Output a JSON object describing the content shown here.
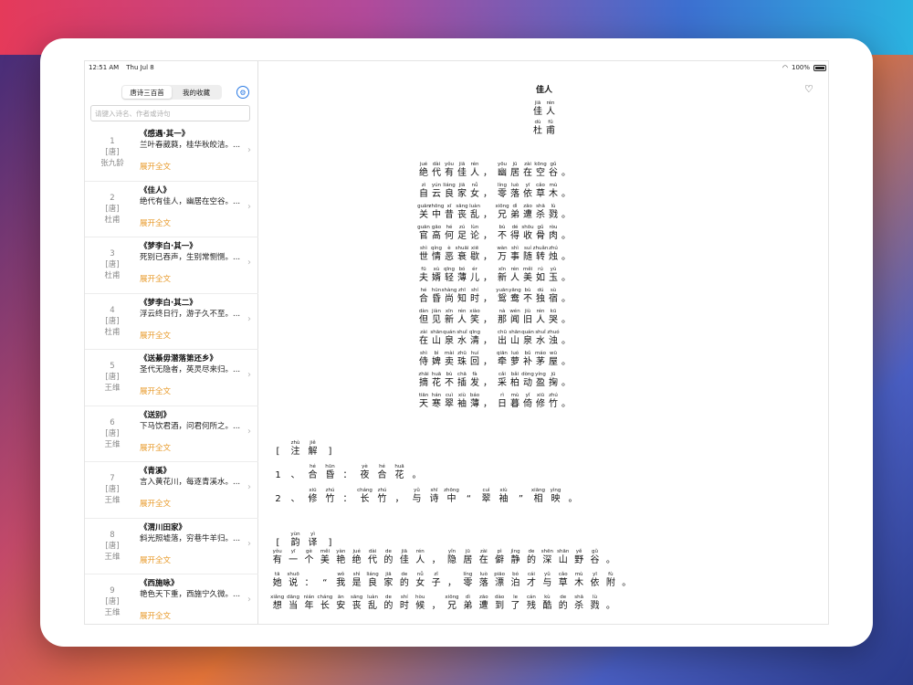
{
  "status": {
    "time": "12:51 AM",
    "date": "Thu Jul 8",
    "battery": "100%"
  },
  "sidebar": {
    "tabs": [
      {
        "label": "唐诗三百首"
      },
      {
        "label": "我的收藏"
      }
    ],
    "search_placeholder": "请键入诗名、作者或诗句",
    "items": [
      {
        "index": "1",
        "dynasty": "[唐]",
        "author": "张九龄",
        "title": "《感遇·其一》",
        "excerpt": "兰叶春葳蕤，桂华秋皎洁。...",
        "expand": "展开全文"
      },
      {
        "index": "2",
        "dynasty": "[唐]",
        "author": "杜甫",
        "title": "《佳人》",
        "excerpt": "绝代有佳人，幽居在空谷。...",
        "expand": "展开全文"
      },
      {
        "index": "3",
        "dynasty": "[唐]",
        "author": "杜甫",
        "title": "《梦李白·其一》",
        "excerpt": "死别已吞声，生别常恻恻。...",
        "expand": "展开全文"
      },
      {
        "index": "4",
        "dynasty": "[唐]",
        "author": "杜甫",
        "title": "《梦李白·其二》",
        "excerpt": "浮云终日行，游子久不至。...",
        "expand": "展开全文"
      },
      {
        "index": "5",
        "dynasty": "[唐]",
        "author": "王维",
        "title": "《送綦毋潜落第还乡》",
        "excerpt": "圣代无隐者，英灵尽来归。...",
        "expand": "展开全文"
      },
      {
        "index": "6",
        "dynasty": "[唐]",
        "author": "王维",
        "title": "《送别》",
        "excerpt": "下马饮君酒，问君何所之。...",
        "expand": "展开全文"
      },
      {
        "index": "7",
        "dynasty": "[唐]",
        "author": "王维",
        "title": "《青溪》",
        "excerpt": "言入黄花川，每逐青溪水。...",
        "expand": "展开全文"
      },
      {
        "index": "8",
        "dynasty": "[唐]",
        "author": "王维",
        "title": "《渭川田家》",
        "excerpt": "斜光照墟落，穷巷牛羊归。...",
        "expand": "展开全文"
      },
      {
        "index": "9",
        "dynasty": "[唐]",
        "author": "王维",
        "title": "《西施咏》",
        "excerpt": "艳色天下重，西施宁久微。...",
        "expand": "展开全文"
      }
    ]
  },
  "main": {
    "title": "佳人",
    "head_title": [
      [
        "jiā",
        "佳"
      ],
      [
        "rén",
        "人"
      ]
    ],
    "head_author": [
      [
        "dù",
        "杜"
      ],
      [
        "fǔ",
        "甫"
      ]
    ],
    "poem_lines": [
      [
        [
          "jué",
          "绝"
        ],
        [
          "dài",
          "代"
        ],
        [
          "yǒu",
          "有"
        ],
        [
          "jiā",
          "佳"
        ],
        [
          "rén",
          "人"
        ],
        [
          "",
          "，"
        ],
        [
          "yōu",
          "幽"
        ],
        [
          "jū",
          "居"
        ],
        [
          "zài",
          "在"
        ],
        [
          "kōng",
          "空"
        ],
        [
          "gǔ",
          "谷"
        ],
        [
          "",
          "。"
        ]
      ],
      [
        [
          "zì",
          "自"
        ],
        [
          "yún",
          "云"
        ],
        [
          "liáng",
          "良"
        ],
        [
          "jiā",
          "家"
        ],
        [
          "nǚ",
          "女"
        ],
        [
          "",
          "，"
        ],
        [
          "líng",
          "零"
        ],
        [
          "luò",
          "落"
        ],
        [
          "yī",
          "依"
        ],
        [
          "cǎo",
          "草"
        ],
        [
          "mù",
          "木"
        ],
        [
          "",
          "。"
        ]
      ],
      [
        [
          "guān",
          "关"
        ],
        [
          "zhōng",
          "中"
        ],
        [
          "xī",
          "昔"
        ],
        [
          "sāng",
          "丧"
        ],
        [
          "luàn",
          "乱"
        ],
        [
          "",
          "，"
        ],
        [
          "xiōng",
          "兄"
        ],
        [
          "dì",
          "弟"
        ],
        [
          "zāo",
          "遭"
        ],
        [
          "shā",
          "杀"
        ],
        [
          "lù",
          "戮"
        ],
        [
          "",
          "。"
        ]
      ],
      [
        [
          "guān",
          "官"
        ],
        [
          "gāo",
          "高"
        ],
        [
          "hé",
          "何"
        ],
        [
          "zú",
          "足"
        ],
        [
          "lùn",
          "论"
        ],
        [
          "",
          "，"
        ],
        [
          "bù",
          "不"
        ],
        [
          "dé",
          "得"
        ],
        [
          "shōu",
          "收"
        ],
        [
          "gǔ",
          "骨"
        ],
        [
          "ròu",
          "肉"
        ],
        [
          "",
          "。"
        ]
      ],
      [
        [
          "shì",
          "世"
        ],
        [
          "qíng",
          "情"
        ],
        [
          "è",
          "恶"
        ],
        [
          "shuāi",
          "衰"
        ],
        [
          "xiē",
          "歇"
        ],
        [
          "",
          "，"
        ],
        [
          "wàn",
          "万"
        ],
        [
          "shì",
          "事"
        ],
        [
          "suí",
          "随"
        ],
        [
          "zhuǎn",
          "转"
        ],
        [
          "zhú",
          "烛"
        ],
        [
          "",
          "。"
        ]
      ],
      [
        [
          "fū",
          "夫"
        ],
        [
          "xù",
          "婿"
        ],
        [
          "qīng",
          "轻"
        ],
        [
          "bó",
          "薄"
        ],
        [
          "ér",
          "儿"
        ],
        [
          "",
          "，"
        ],
        [
          "xīn",
          "新"
        ],
        [
          "rén",
          "人"
        ],
        [
          "měi",
          "美"
        ],
        [
          "rú",
          "如"
        ],
        [
          "yù",
          "玉"
        ],
        [
          "",
          "。"
        ]
      ],
      [
        [
          "hé",
          "合"
        ],
        [
          "hūn",
          "昏"
        ],
        [
          "shàng",
          "尚"
        ],
        [
          "zhī",
          "知"
        ],
        [
          "shí",
          "时"
        ],
        [
          "",
          "，"
        ],
        [
          "yuān",
          "鸳"
        ],
        [
          "yāng",
          "鸯"
        ],
        [
          "bù",
          "不"
        ],
        [
          "dú",
          "独"
        ],
        [
          "sù",
          "宿"
        ],
        [
          "",
          "。"
        ]
      ],
      [
        [
          "dàn",
          "但"
        ],
        [
          "jiàn",
          "见"
        ],
        [
          "xīn",
          "新"
        ],
        [
          "rén",
          "人"
        ],
        [
          "xiào",
          "笑"
        ],
        [
          "",
          "，"
        ],
        [
          "nà",
          "那"
        ],
        [
          "wén",
          "闻"
        ],
        [
          "jiù",
          "旧"
        ],
        [
          "rén",
          "人"
        ],
        [
          "kū",
          "哭"
        ],
        [
          "",
          "。"
        ]
      ],
      [
        [
          "zài",
          "在"
        ],
        [
          "shān",
          "山"
        ],
        [
          "quán",
          "泉"
        ],
        [
          "shuǐ",
          "水"
        ],
        [
          "qīng",
          "清"
        ],
        [
          "",
          "，"
        ],
        [
          "chū",
          "出"
        ],
        [
          "shān",
          "山"
        ],
        [
          "quán",
          "泉"
        ],
        [
          "shuǐ",
          "水"
        ],
        [
          "zhuó",
          "浊"
        ],
        [
          "",
          "。"
        ]
      ],
      [
        [
          "shì",
          "侍"
        ],
        [
          "bì",
          "婢"
        ],
        [
          "mài",
          "卖"
        ],
        [
          "zhū",
          "珠"
        ],
        [
          "huí",
          "回"
        ],
        [
          "",
          "，"
        ],
        [
          "qiān",
          "牵"
        ],
        [
          "luó",
          "萝"
        ],
        [
          "bǔ",
          "补"
        ],
        [
          "máo",
          "茅"
        ],
        [
          "wū",
          "屋"
        ],
        [
          "",
          "。"
        ]
      ],
      [
        [
          "zhāi",
          "摘"
        ],
        [
          "huā",
          "花"
        ],
        [
          "bù",
          "不"
        ],
        [
          "chā",
          "插"
        ],
        [
          "fà",
          "发"
        ],
        [
          "",
          "，"
        ],
        [
          "cǎi",
          "采"
        ],
        [
          "bǎi",
          "柏"
        ],
        [
          "dòng",
          "动"
        ],
        [
          "yíng",
          "盈"
        ],
        [
          "jū",
          "掬"
        ],
        [
          "",
          "。"
        ]
      ],
      [
        [
          "tiān",
          "天"
        ],
        [
          "hán",
          "寒"
        ],
        [
          "cuì",
          "翠"
        ],
        [
          "xiù",
          "袖"
        ],
        [
          "báo",
          "薄"
        ],
        [
          "",
          "，"
        ],
        [
          "rì",
          "日"
        ],
        [
          "mù",
          "暮"
        ],
        [
          "yǐ",
          "倚"
        ],
        [
          "xiū",
          "修"
        ],
        [
          "zhú",
          "竹"
        ],
        [
          "",
          "。"
        ]
      ]
    ],
    "notes_header": [
      [
        "",
        "["
      ],
      [
        "zhù",
        "注"
      ],
      [
        "jiě",
        "解"
      ],
      [
        "",
        "]"
      ]
    ],
    "notes": [
      [
        [
          "",
          "1"
        ],
        [
          "",
          "、"
        ],
        [
          "hé",
          "合"
        ],
        [
          "hūn",
          "昏"
        ],
        [
          "",
          "："
        ],
        [
          "yè",
          "夜"
        ],
        [
          "hé",
          "合"
        ],
        [
          "huā",
          "花"
        ],
        [
          "",
          "。"
        ]
      ],
      [
        [
          "",
          "2"
        ],
        [
          "",
          "、"
        ],
        [
          "xiū",
          "修"
        ],
        [
          "zhú",
          "竹"
        ],
        [
          "",
          "："
        ],
        [
          "cháng",
          "长"
        ],
        [
          "zhú",
          "竹"
        ],
        [
          "",
          "，"
        ],
        [
          "yǔ",
          "与"
        ],
        [
          "shī",
          "诗"
        ],
        [
          "zhōng",
          "中"
        ],
        [
          "",
          "“"
        ],
        [
          "cuì",
          "翠"
        ],
        [
          "xiù",
          "袖"
        ],
        [
          "",
          "”"
        ],
        [
          "xiāng",
          "相"
        ],
        [
          "yìng",
          "映"
        ],
        [
          "",
          "。"
        ]
      ]
    ],
    "trans_header": [
      [
        "",
        "["
      ],
      [
        "yùn",
        "韵"
      ],
      [
        "yì",
        "译"
      ],
      [
        "",
        "]"
      ]
    ],
    "trans": [
      [
        [
          "yǒu",
          "有"
        ],
        [
          "yī",
          "一"
        ],
        [
          "gè",
          "个"
        ],
        [
          "měi",
          "美"
        ],
        [
          "yàn",
          "艳"
        ],
        [
          "jué",
          "绝"
        ],
        [
          "dài",
          "代"
        ],
        [
          "de",
          "的"
        ],
        [
          "jiā",
          "佳"
        ],
        [
          "rén",
          "人"
        ],
        [
          "",
          "，"
        ],
        [
          "yǐn",
          "隐"
        ],
        [
          "jū",
          "居"
        ],
        [
          "zài",
          "在"
        ],
        [
          "pì",
          "僻"
        ],
        [
          "jìng",
          "静"
        ],
        [
          "de",
          "的"
        ],
        [
          "shēn",
          "深"
        ],
        [
          "shān",
          "山"
        ],
        [
          "yě",
          "野"
        ],
        [
          "gǔ",
          "谷"
        ],
        [
          "",
          "。"
        ]
      ],
      [
        [
          "tā",
          "她"
        ],
        [
          "shuō",
          "说"
        ],
        [
          "",
          "："
        ],
        [
          "",
          "“"
        ],
        [
          "wǒ",
          "我"
        ],
        [
          "shì",
          "是"
        ],
        [
          "liáng",
          "良"
        ],
        [
          "jiā",
          "家"
        ],
        [
          "de",
          "的"
        ],
        [
          "nǚ",
          "女"
        ],
        [
          "zǐ",
          "子"
        ],
        [
          "",
          "，"
        ],
        [
          "líng",
          "零"
        ],
        [
          "luò",
          "落"
        ],
        [
          "piāo",
          "漂"
        ],
        [
          "bó",
          "泊"
        ],
        [
          "cái",
          "才"
        ],
        [
          "yǔ",
          "与"
        ],
        [
          "cǎo",
          "草"
        ],
        [
          "mù",
          "木"
        ],
        [
          "yī",
          "依"
        ],
        [
          "fù",
          "附"
        ],
        [
          "",
          "。"
        ]
      ],
      [
        [
          "xiǎng",
          "想"
        ],
        [
          "dāng",
          "当"
        ],
        [
          "nián",
          "年"
        ],
        [
          "cháng",
          "长"
        ],
        [
          "ān",
          "安"
        ],
        [
          "sāng",
          "丧"
        ],
        [
          "luàn",
          "乱"
        ],
        [
          "de",
          "的"
        ],
        [
          "shí",
          "时"
        ],
        [
          "hòu",
          "候"
        ],
        [
          "",
          "，"
        ],
        [
          "xiōng",
          "兄"
        ],
        [
          "dì",
          "弟"
        ],
        [
          "zāo",
          "遭"
        ],
        [
          "dào",
          "到"
        ],
        [
          "le",
          "了"
        ],
        [
          "cán",
          "残"
        ],
        [
          "kù",
          "酷"
        ],
        [
          "de",
          "的"
        ],
        [
          "shā",
          "杀"
        ],
        [
          "lù",
          "戮"
        ],
        [
          "",
          "。"
        ]
      ]
    ]
  },
  "icons": {
    "settings": "gear-icon",
    "heart": "heart-icon",
    "chevron": "chevron-right-icon",
    "wifi": "wifi-icon",
    "battery": "battery-icon"
  }
}
